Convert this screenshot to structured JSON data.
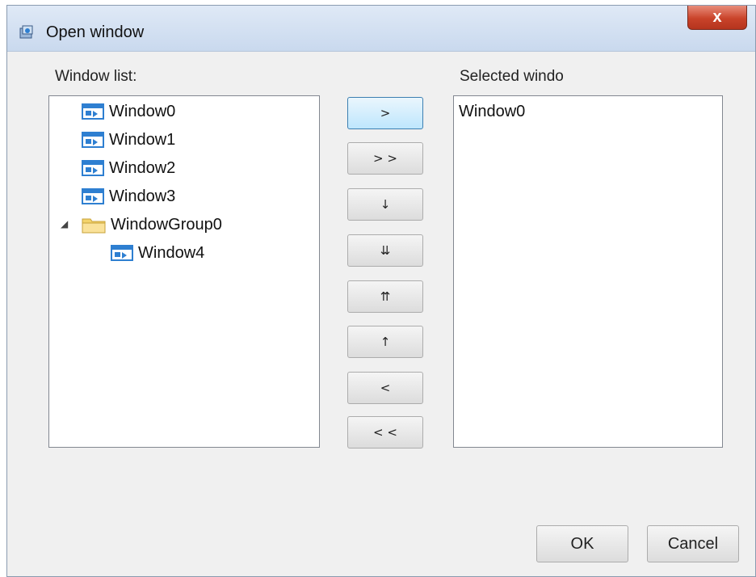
{
  "window": {
    "title": "Open window",
    "close_glyph": "x",
    "icon": "open-window-app-icon"
  },
  "left_panel": {
    "label": "Window list:",
    "items": [
      {
        "label": "Window0",
        "icon": "window-icon",
        "indent": 0
      },
      {
        "label": "Window1",
        "icon": "window-icon",
        "indent": 0
      },
      {
        "label": "Window2",
        "icon": "window-icon",
        "indent": 0
      },
      {
        "label": "Window3",
        "icon": "window-icon",
        "indent": 0
      },
      {
        "label": "WindowGroup0",
        "icon": "folder-icon",
        "indent": 0,
        "expanded": true
      },
      {
        "label": "Window4",
        "icon": "window-icon",
        "indent": 1
      }
    ],
    "expander_glyph": "◢"
  },
  "buttons": {
    "add": ">",
    "add_all": "> >",
    "move_down": "↓",
    "move_bottom": "⇊",
    "move_top": "⇈",
    "move_up": "↑",
    "remove": "<",
    "remove_all": "< <"
  },
  "right_panel": {
    "label": "Selected windo",
    "items": [
      "Window0"
    ]
  },
  "footer": {
    "ok": "OK",
    "cancel": "Cancel"
  },
  "colors": {
    "titlebar": "#c9d9ee",
    "close_button": "#c9432a",
    "default_button_border": "#3c7fb1",
    "window_icon_blue": "#2e7fd1",
    "folder_yellow": "#f3d36b"
  }
}
